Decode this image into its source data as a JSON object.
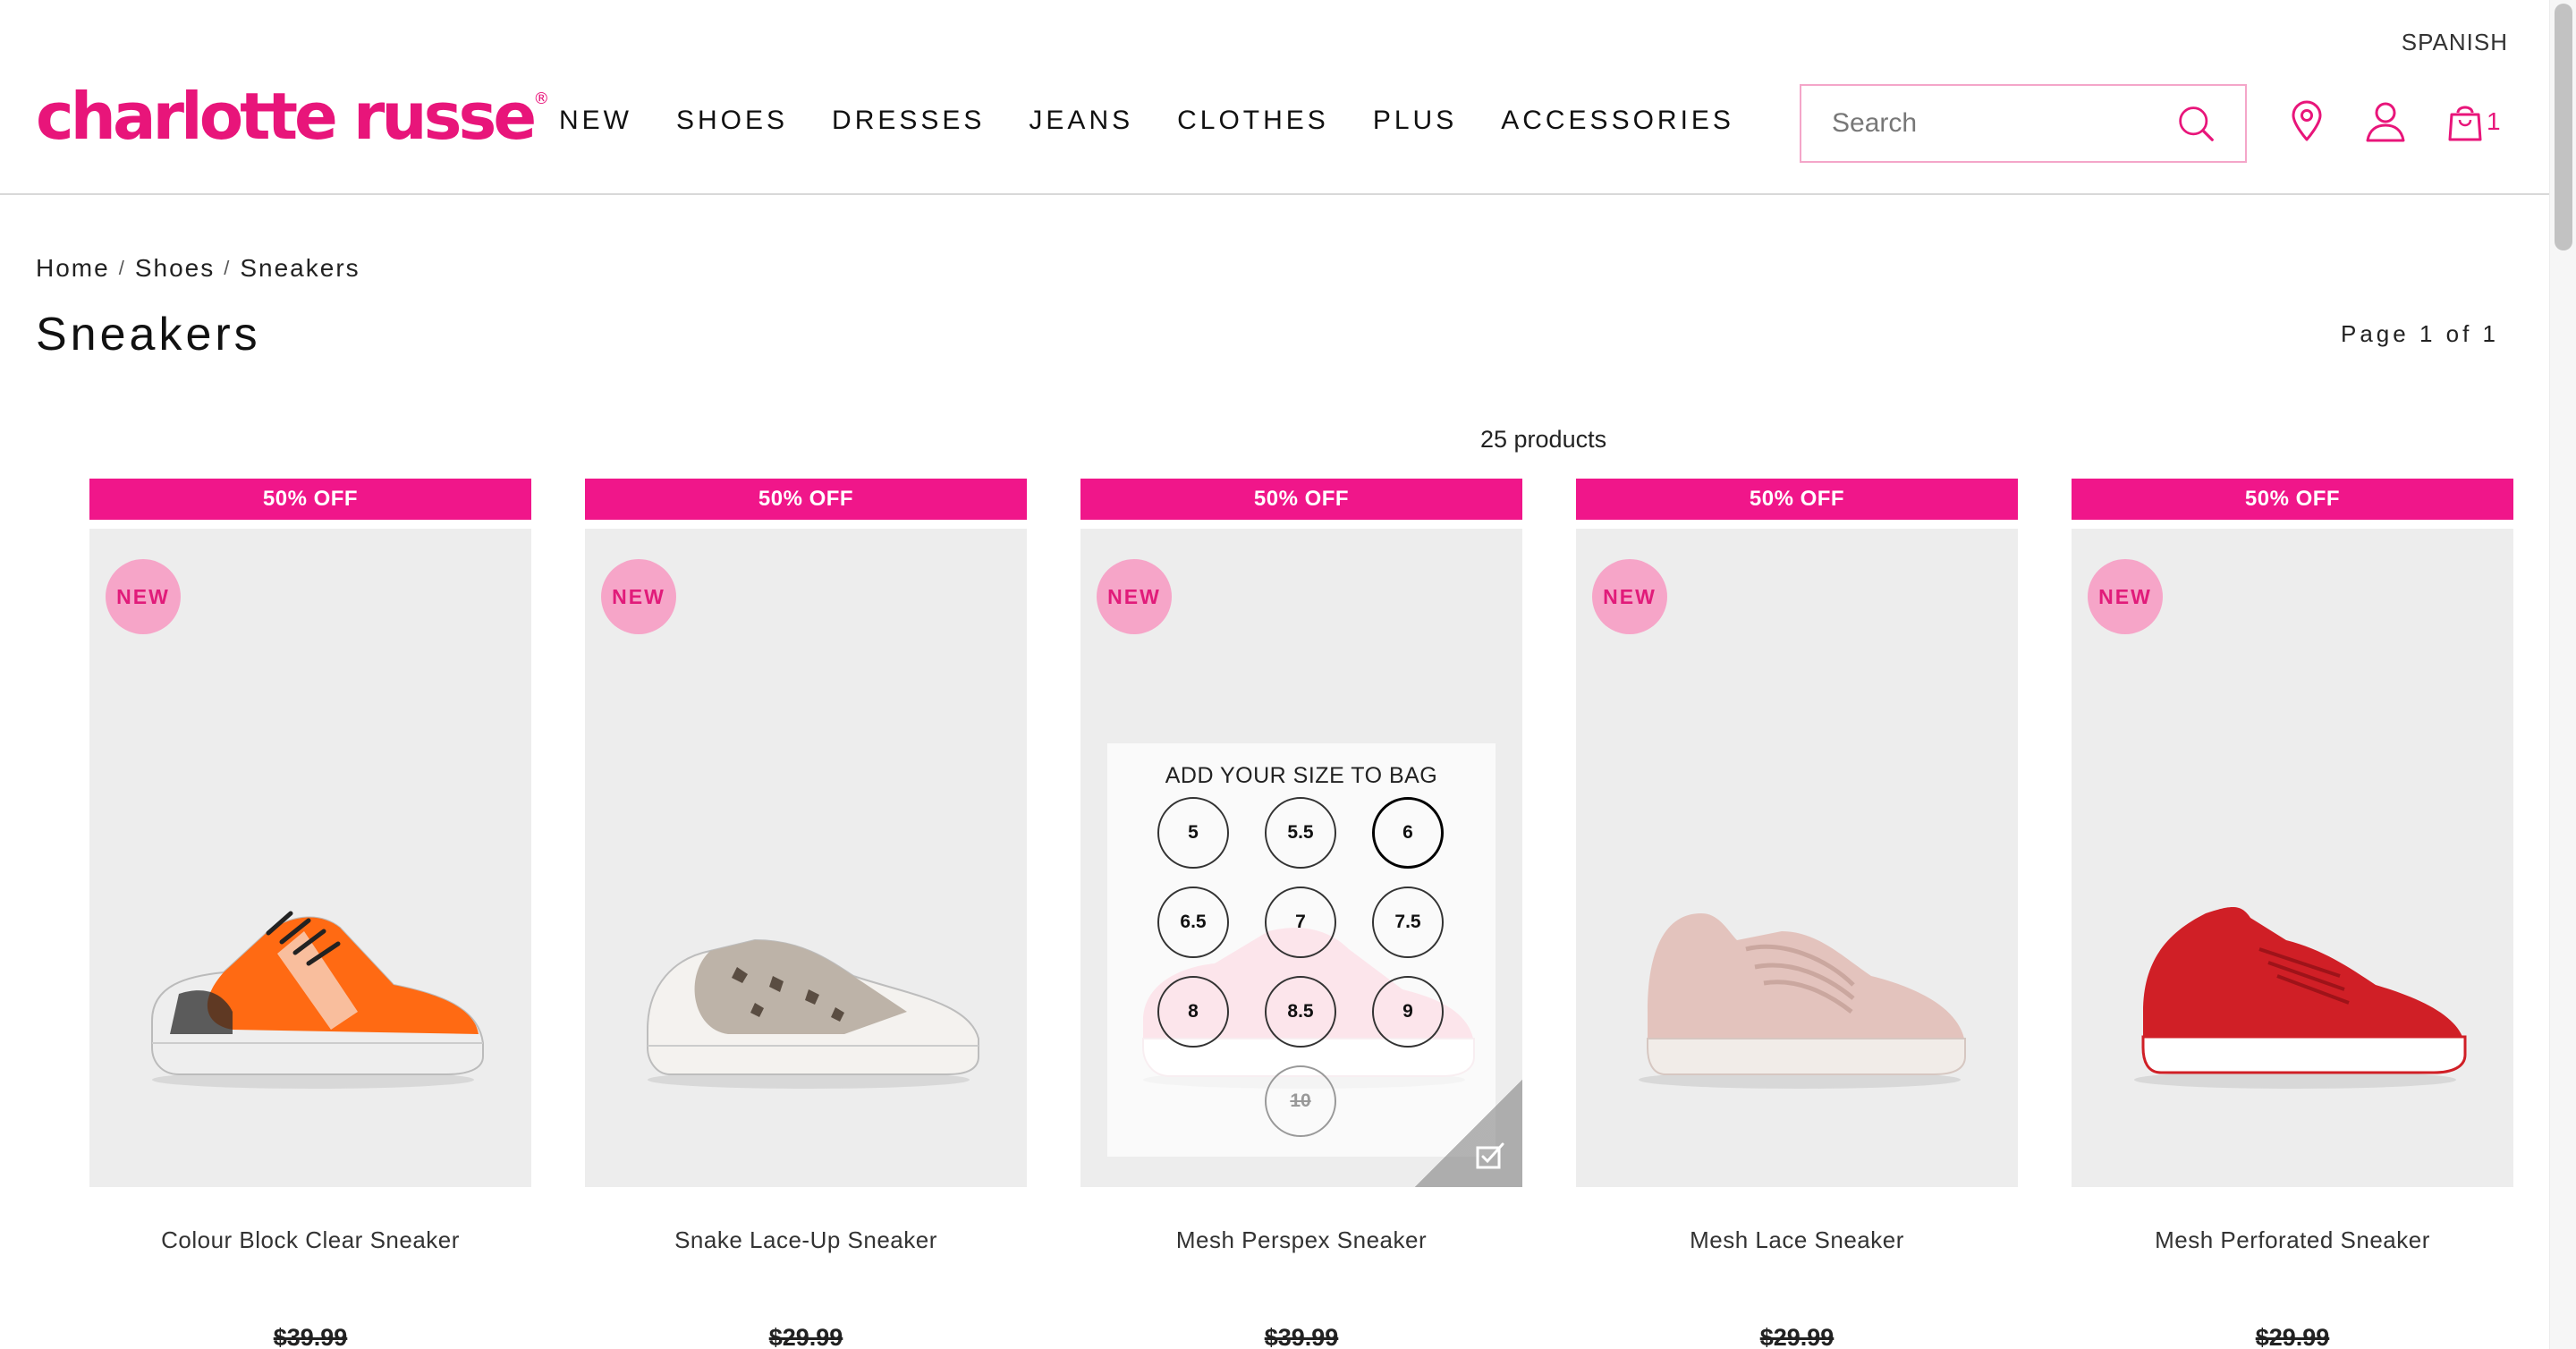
{
  "header": {
    "language_link": "SPANISH",
    "logo_text": "charlotte russe",
    "logo_mark": "®",
    "nav": [
      "NEW",
      "SHOES",
      "DRESSES",
      "JEANS",
      "CLOTHES",
      "PLUS",
      "ACCESSORIES"
    ],
    "search_placeholder": "Search",
    "bag_count": "1",
    "icons": [
      "search-icon",
      "location-pin-icon",
      "user-icon",
      "shopping-bag-icon"
    ],
    "brand_color": "#e8157a"
  },
  "breadcrumb": {
    "items": [
      "Home",
      "Shoes",
      "Sneakers"
    ],
    "separator": "/"
  },
  "page": {
    "title": "Sneakers",
    "pagination": "Page 1 of 1",
    "product_count": "25 products"
  },
  "products": [
    {
      "promo": "50% OFF",
      "badge": "NEW",
      "name": "Colour Block Clear Sneaker",
      "price": "$39.99",
      "shoe_color": "#ff6a13"
    },
    {
      "promo": "50% OFF",
      "badge": "NEW",
      "name": "Snake Lace-Up Sneaker",
      "price": "$29.99",
      "shoe_color": "#bdb3a8"
    },
    {
      "promo": "50% OFF",
      "badge": "NEW",
      "name": "Mesh Perspex Sneaker",
      "price": "$39.99",
      "shoe_color": "#f2a3b6"
    },
    {
      "promo": "50% OFF",
      "badge": "NEW",
      "name": "Mesh Lace Sneaker",
      "price": "$29.99",
      "shoe_color": "#e3c3bd"
    },
    {
      "promo": "50% OFF",
      "badge": "NEW",
      "name": "Mesh Perforated Sneaker",
      "price": "$29.99",
      "shoe_color": "#d01f26"
    }
  ],
  "size_overlay": {
    "heading": "ADD YOUR SIZE TO BAG",
    "sizes": [
      "5",
      "5.5",
      "6",
      "6.5",
      "7",
      "7.5",
      "8",
      "8.5",
      "9",
      "10"
    ],
    "selected": "6",
    "unavailable": [
      "10"
    ]
  },
  "colors": {
    "promo_bar": "#f0168a",
    "new_badge": "#f6a5c8",
    "search_border": "#f4a6c9"
  }
}
